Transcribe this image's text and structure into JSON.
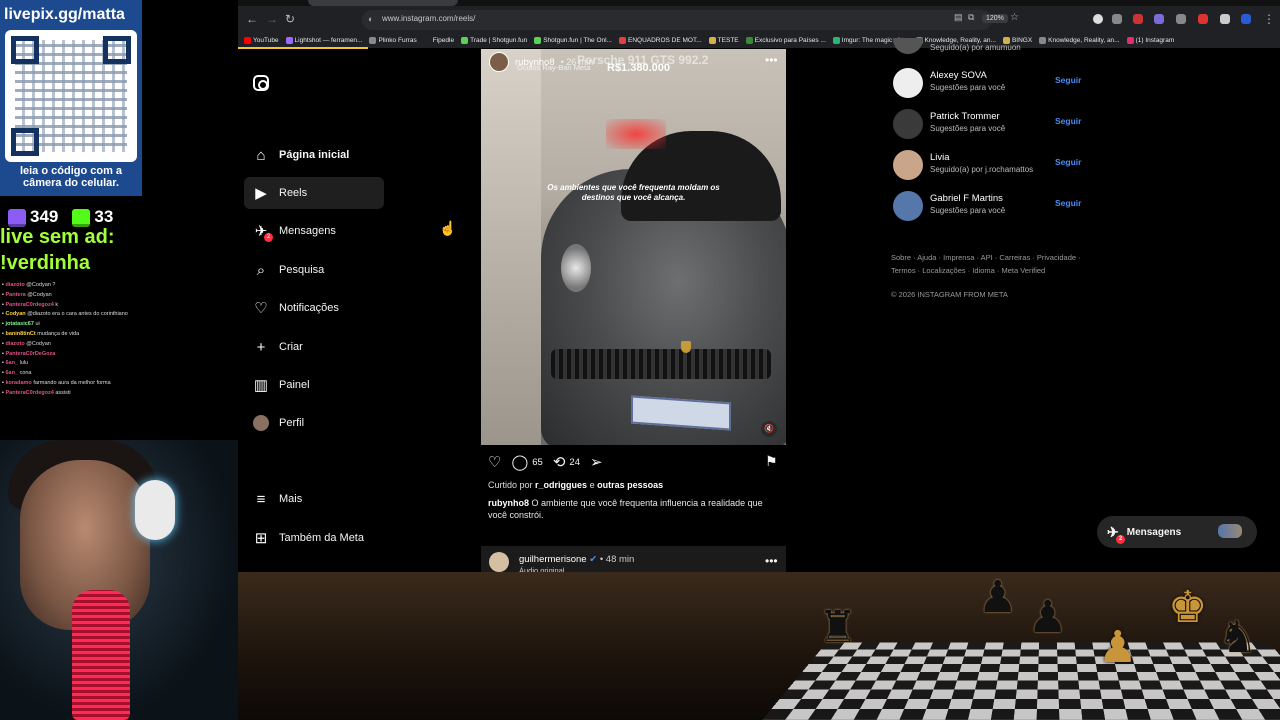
{
  "browser": {
    "url": "www.instagram.com/reels/",
    "zoom": "120%",
    "bookmarks": [
      {
        "label": "YouTube",
        "color": "#ff0000"
      },
      {
        "label": "Lightshot — ferramen...",
        "color": "#9b6bff"
      },
      {
        "label": "Plinko Furras",
        "color": "#8a8a8a"
      },
      {
        "label": "Fipedle",
        "color": "#222222"
      },
      {
        "label": "Trade | Shotgun.fun",
        "color": "#5ad15a"
      },
      {
        "label": "Shotgun.fun | The Onl...",
        "color": "#5ad15a"
      },
      {
        "label": "ENQUADROS DE MOT...",
        "color": "#e04040"
      },
      {
        "label": "TESTE",
        "color": "#d4b04a"
      },
      {
        "label": "Exclusivo para Países ...",
        "color": "#3a8a3a"
      },
      {
        "label": "Imgur: The magic of t...",
        "color": "#2ab673"
      },
      {
        "label": "Knowledge, Reality, an...",
        "color": "#888888"
      },
      {
        "label": "BINGX",
        "color": "#d4b04a"
      },
      {
        "label": "Knowledge, Reality, an...",
        "color": "#888888"
      },
      {
        "label": "(1) Instagram",
        "color": "#e1306c"
      }
    ]
  },
  "sidebar": {
    "items": [
      {
        "label": "Página inicial",
        "icon": "home-icon"
      },
      {
        "label": "Reels",
        "icon": "reels-icon"
      },
      {
        "label": "Mensagens",
        "icon": "messages-icon",
        "badge": "2"
      },
      {
        "label": "Pesquisa",
        "icon": "search-icon"
      },
      {
        "label": "Notificações",
        "icon": "heart-icon"
      },
      {
        "label": "Criar",
        "icon": "plus-icon"
      },
      {
        "label": "Painel",
        "icon": "dashboard-icon"
      },
      {
        "label": "Perfil",
        "icon": "avatar-icon"
      },
      {
        "label": "Mais",
        "icon": "menu-icon"
      },
      {
        "label": "Também da Meta",
        "icon": "meta-icon"
      }
    ]
  },
  "post": {
    "user": "rubynho8",
    "time": "• 26 min",
    "sub": "Óculos Ray-Ban Meta",
    "overlay_title": "Porsche 911 GTS 992.2",
    "overlay_price": "R$1.380.000",
    "overlay_caption": "Os ambientes que você frequenta moldam os destinos que você alcança.",
    "comments": "65",
    "reposts": "24",
    "liked_prefix": "Curtido por",
    "liked_user": "r_odriggues",
    "liked_suffix": "e",
    "liked_others": "outras pessoas",
    "caption_user": "rubynho8",
    "caption_text": "O ambiente que você frequenta influencia a realidade que você constrói."
  },
  "post2": {
    "user": "guilhermerisone",
    "time": "• 48 min",
    "sub": "Áudio original"
  },
  "suggestions": {
    "top_partial": "Seguido(a) por amumuon",
    "follow_label": "Seguir",
    "items": [
      {
        "name": "Alexey SOVA",
        "sub": "Sugestões para você",
        "color": "#eeeeee"
      },
      {
        "name": "Patrick Trommer",
        "sub": "Sugestões para você",
        "color": "#3a3a3a"
      },
      {
        "name": "Livia",
        "sub": "Seguido(a) por j.rochamattos",
        "color": "#c9a68a"
      },
      {
        "name": "Gabriel F Martins",
        "sub": "Sugestões para você",
        "color": "#5577aa"
      }
    ]
  },
  "footer": {
    "links_line1": "Sobre · Ajuda · Imprensa · API · Carreiras · Privacidade ·",
    "links_line2": "Termos · Localizações · Idioma · Meta Verified",
    "copyright": "© 2026 INSTAGRAM FROM META"
  },
  "messages_pill": {
    "label": "Mensagens",
    "badge": "2"
  },
  "stream": {
    "qr_title": "livepix.gg/matta",
    "qr_caption": "leia o código com a câmera do celular.",
    "twitch_count": "349",
    "kick_count": "33",
    "ad_line1": "live sem ad:",
    "ad_line2": "!verdinha",
    "chat": [
      {
        "name": "diazoto",
        "text": "@Codyan ?",
        "cls": "n"
      },
      {
        "name": "Pantera",
        "text": "@Codyan",
        "cls": "n"
      },
      {
        "name": "PanteraC0rdegoz4",
        "text": "k",
        "cls": "n"
      },
      {
        "name": "Codyan",
        "text": "@diazoto era o cara antes do corinthiano",
        "cls": "n2"
      },
      {
        "name": "jotatasic67",
        "text": "ui",
        "cls": "n3"
      },
      {
        "name": "banin8tinCt",
        "text": "mudança de vida",
        "cls": "n2"
      },
      {
        "name": "diazoto",
        "text": "@Codyan",
        "cls": "n"
      },
      {
        "name": "PanteraC0rDeGoza",
        "text": "",
        "cls": "n"
      },
      {
        "name": "6an_",
        "text": "lulu",
        "cls": "n"
      },
      {
        "name": "6an_",
        "text": "cona",
        "cls": "n"
      },
      {
        "name": "koradamo",
        "text": "farmando aura da melhor forma",
        "cls": "n"
      },
      {
        "name": "PanteraC0rdegoz4",
        "text": "assisti",
        "cls": "n"
      }
    ]
  }
}
